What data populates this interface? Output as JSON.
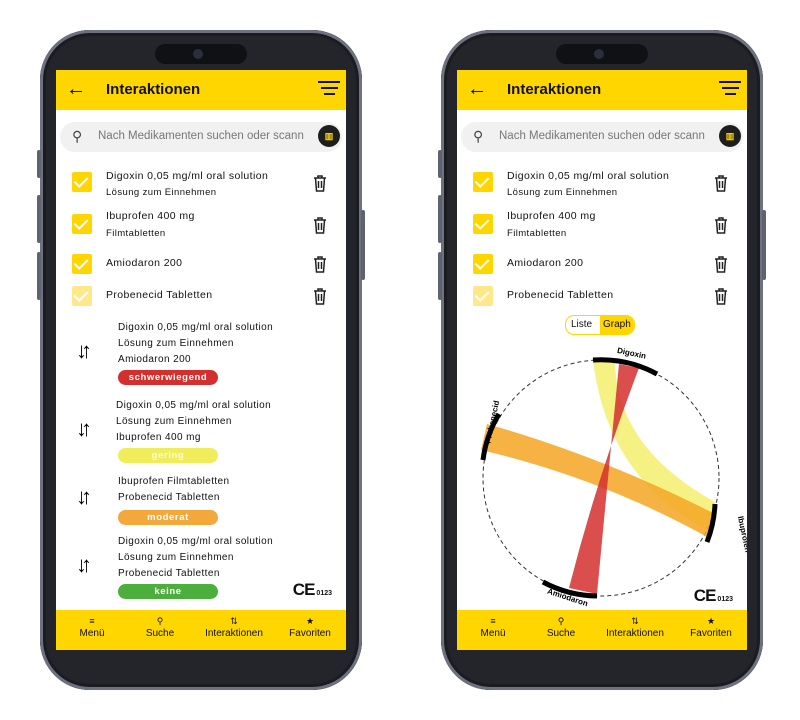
{
  "colors": {
    "accent": "#ffd600",
    "severe": "#d32f2f",
    "minor": "#f1ec5a",
    "moderate": "#f2a83a",
    "none": "#4cae3c"
  },
  "app": {
    "title": "Interaktionen"
  },
  "search": {
    "placeholder": "Nach Medikamenten suchen oder scann"
  },
  "medications": [
    {
      "name": "Digoxin 0,05 mg/ml oral solution",
      "form": "Lösung zum Einnehmen"
    },
    {
      "name": "Ibuprofen  400 mg",
      "form": "Filmtabletten"
    },
    {
      "name": "Amiodaron 200",
      "form": ""
    },
    {
      "name": "Probenecid Tabletten",
      "form": ""
    }
  ],
  "interactions": [
    {
      "line1": "Digoxin 0,05 mg/ml oral solution",
      "line2": "Lösung zum Einnehmen",
      "line3": "Amiodaron 200",
      "severity": "schwerwiegend"
    },
    {
      "line1": "Digoxin 0,05 mg/ml oral solution",
      "line2": "Lösung zum Einnehmen",
      "line3": "Ibuprofen 400 mg",
      "severity": "gering"
    },
    {
      "line1": "Ibuprofen Filmtabletten",
      "line2": "Probenecid Tabletten",
      "line3": "",
      "severity": "moderat"
    },
    {
      "line1": "Digoxin 0,05 mg/ml oral solution",
      "line2": "Lösung zum Einnehmen",
      "line3": "Probenecid Tabletten",
      "severity": "keine"
    }
  ],
  "view_toggle": {
    "list_label": "Liste",
    "graph_label": "Graph"
  },
  "chord_labels": {
    "digoxin": "Digoxin",
    "ibuprofen": "Ibuprofen",
    "amiodaron": "Amiodaron",
    "probenecid": "Probenecid"
  },
  "ce_mark": {
    "symbol": "CE",
    "number": "0123"
  },
  "nav": [
    {
      "icon": "menu-icon",
      "glyph": "≡",
      "label": "Menü"
    },
    {
      "icon": "search-icon",
      "glyph": "⚲",
      "label": "Suche"
    },
    {
      "icon": "swap-icon",
      "glyph": "⇅",
      "label": "Interaktionen"
    },
    {
      "icon": "star-icon",
      "glyph": "★",
      "label": "Favoriten"
    }
  ]
}
